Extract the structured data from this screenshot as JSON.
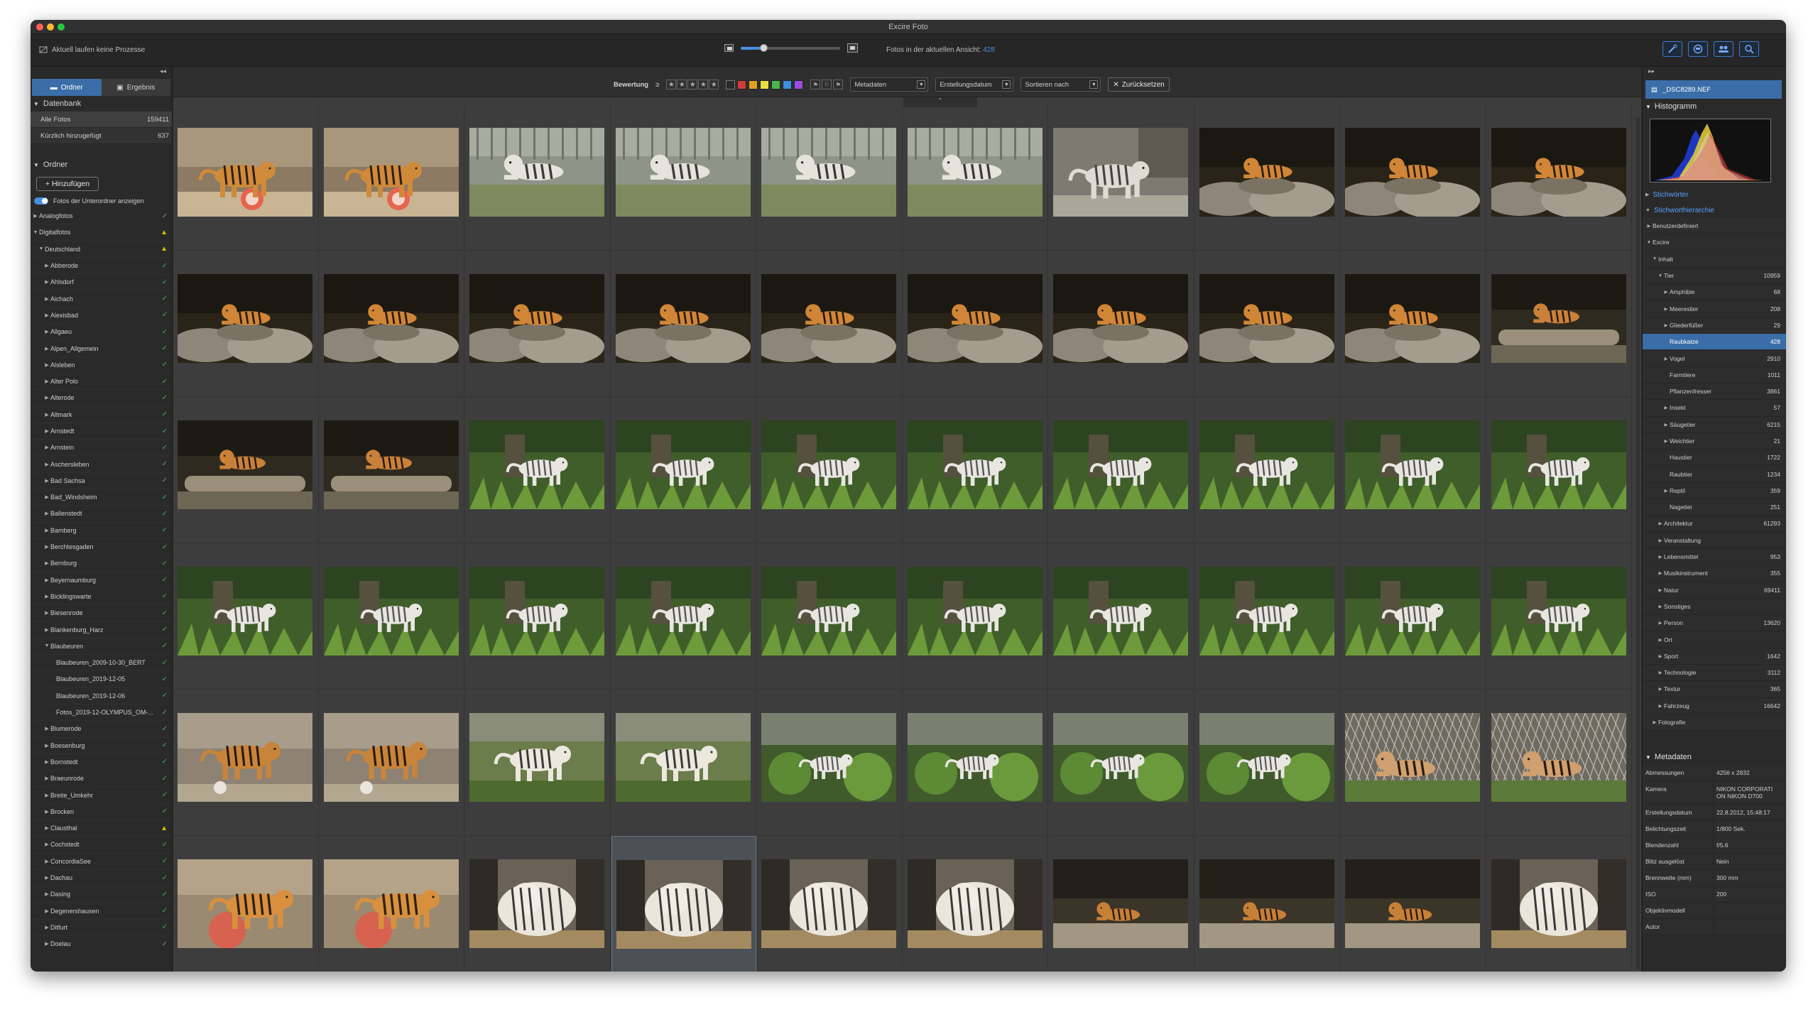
{
  "window": {
    "title": "Excire Foto"
  },
  "toolbar": {
    "process_status": "Aktuell laufen keine Prozesse",
    "zoom_level": 0.2,
    "view_count_label": "Fotos in der aktuellen Ansicht:",
    "view_count": "428",
    "icons": [
      "magic-wand-icon",
      "face-icon",
      "people-icon",
      "search-icon"
    ]
  },
  "left_panel": {
    "collapse_label": "◂◂",
    "tabs": [
      {
        "label": "Ordner",
        "icon": "folder-icon",
        "active": true
      },
      {
        "label": "Ergebnis",
        "icon": "result-icon",
        "active": false
      }
    ],
    "database": {
      "title": "Datenbank",
      "rows": [
        {
          "label": "Alle Fotos",
          "count": "159411"
        },
        {
          "label": "Kürzlich hinzugefügt",
          "count": "637"
        }
      ]
    },
    "folders": {
      "title": "Ordner",
      "add_label": "+ Hinzufügen",
      "subfolder_toggle": "Fotos der Unterordner anzeigen",
      "tree": [
        {
          "label": "Analogfotos",
          "indent": 0,
          "arrow": "▶",
          "status": "ok"
        },
        {
          "label": "Digitalfotos",
          "indent": 0,
          "arrow": "▼",
          "status": "warn"
        },
        {
          "label": "Deutschland",
          "indent": 1,
          "arrow": "▼",
          "status": "warn"
        },
        {
          "label": "Abberode",
          "indent": 2,
          "arrow": "▶",
          "status": "ok"
        },
        {
          "label": "Ahlsdorf",
          "indent": 2,
          "arrow": "▶",
          "status": "ok"
        },
        {
          "label": "Aichach",
          "indent": 2,
          "arrow": "▶",
          "status": "ok"
        },
        {
          "label": "Alexisbad",
          "indent": 2,
          "arrow": "▶",
          "status": "ok"
        },
        {
          "label": "Allgaeu",
          "indent": 2,
          "arrow": "▶",
          "status": "ok"
        },
        {
          "label": "Alpen_Allgemein",
          "indent": 2,
          "arrow": "▶",
          "status": "ok"
        },
        {
          "label": "Alsleben",
          "indent": 2,
          "arrow": "▶",
          "status": "ok"
        },
        {
          "label": "Alter Polo",
          "indent": 2,
          "arrow": "▶",
          "status": "ok"
        },
        {
          "label": "Alterode",
          "indent": 2,
          "arrow": "▶",
          "status": "ok"
        },
        {
          "label": "Altmark",
          "indent": 2,
          "arrow": "▶",
          "status": "ok"
        },
        {
          "label": "Arnstedt",
          "indent": 2,
          "arrow": "▶",
          "status": "ok"
        },
        {
          "label": "Arnstein",
          "indent": 2,
          "arrow": "▶",
          "status": "ok"
        },
        {
          "label": "Aschersleben",
          "indent": 2,
          "arrow": "▶",
          "status": "ok"
        },
        {
          "label": "Bad Sachsa",
          "indent": 2,
          "arrow": "▶",
          "status": "ok"
        },
        {
          "label": "Bad_Windsheim",
          "indent": 2,
          "arrow": "▶",
          "status": "ok"
        },
        {
          "label": "Ballenstedt",
          "indent": 2,
          "arrow": "▶",
          "status": "ok"
        },
        {
          "label": "Bamberg",
          "indent": 2,
          "arrow": "▶",
          "status": "ok"
        },
        {
          "label": "Berchtesgaden",
          "indent": 2,
          "arrow": "▶",
          "status": "ok"
        },
        {
          "label": "Bernburg",
          "indent": 2,
          "arrow": "▶",
          "status": "ok"
        },
        {
          "label": "Beyernaumburg",
          "indent": 2,
          "arrow": "▶",
          "status": "ok"
        },
        {
          "label": "Bicklingswarte",
          "indent": 2,
          "arrow": "▶",
          "status": "ok"
        },
        {
          "label": "Biesenrode",
          "indent": 2,
          "arrow": "▶",
          "status": "ok"
        },
        {
          "label": "Blankenburg_Harz",
          "indent": 2,
          "arrow": "▶",
          "status": "ok"
        },
        {
          "label": "Blaubeuren",
          "indent": 2,
          "arrow": "▼",
          "status": "ok"
        },
        {
          "label": "Blaubeuren_2009-10-30_BERT",
          "indent": 3,
          "arrow": "",
          "status": "ok"
        },
        {
          "label": "Blaubeuren_2019-12-05",
          "indent": 3,
          "arrow": "",
          "status": "ok"
        },
        {
          "label": "Blaubeuren_2019-12-06",
          "indent": 3,
          "arrow": "",
          "status": "ok"
        },
        {
          "label": "Fotos_2019-12-OLYMPUS_OM-...",
          "indent": 3,
          "arrow": "",
          "status": "ok"
        },
        {
          "label": "Blumerode",
          "indent": 2,
          "arrow": "▶",
          "status": "ok"
        },
        {
          "label": "Boesenburg",
          "indent": 2,
          "arrow": "▶",
          "status": "ok"
        },
        {
          "label": "Bornstedt",
          "indent": 2,
          "arrow": "▶",
          "status": "ok"
        },
        {
          "label": "Braeunrode",
          "indent": 2,
          "arrow": "▶",
          "status": "ok"
        },
        {
          "label": "Breite_Umkehr",
          "indent": 2,
          "arrow": "▶",
          "status": "ok"
        },
        {
          "label": "Brocken",
          "indent": 2,
          "arrow": "▶",
          "status": "ok"
        },
        {
          "label": "Clausthal",
          "indent": 2,
          "arrow": "▶",
          "status": "warn"
        },
        {
          "label": "Cochstedt",
          "indent": 2,
          "arrow": "▶",
          "status": "ok"
        },
        {
          "label": "ConcordiaSee",
          "indent": 2,
          "arrow": "▶",
          "status": "ok"
        },
        {
          "label": "Dachau",
          "indent": 2,
          "arrow": "▶",
          "status": "ok"
        },
        {
          "label": "Dasing",
          "indent": 2,
          "arrow": "▶",
          "status": "ok"
        },
        {
          "label": "Degenershausen",
          "indent": 2,
          "arrow": "▶",
          "status": "ok"
        },
        {
          "label": "Ditfurt",
          "indent": 2,
          "arrow": "▶",
          "status": "ok"
        },
        {
          "label": "Doelau",
          "indent": 2,
          "arrow": "▶",
          "status": "ok"
        }
      ]
    }
  },
  "filter_bar": {
    "rating_label": "Bewertung",
    "rating_op": "≥",
    "stars": [
      "★",
      "★",
      "★",
      "★",
      "★"
    ],
    "colors": [
      "#d33b3b",
      "#e0a020",
      "#e8e040",
      "#49b54a",
      "#3b8fe0",
      "#9b4be0"
    ],
    "flags": [
      "⚑",
      "⚐",
      "⚑"
    ],
    "dropdowns": [
      "Metadaten",
      "Erstellungsdatum",
      "Sortieren nach"
    ],
    "reset_label": "Zurücksetzen",
    "collapse_icon": "⌃"
  },
  "grid": {
    "rows": [
      [
        "tiger-walk",
        "tiger-walk",
        "whitetiger-lying",
        "whitetiger-lying",
        "whitetiger-lying",
        "whitetiger-lying",
        "whitetiger-walk",
        "tiger-rocks",
        "tiger-rocks",
        "tiger-rocks"
      ],
      [
        "tiger-rocks",
        "tiger-rocks",
        "tiger-rocks",
        "tiger-rocks",
        "tiger-rocks",
        "tiger-rocks",
        "tiger-rocks",
        "tiger-rocks",
        "tiger-rocks",
        "tiger-log"
      ],
      [
        "tiger-log",
        "tiger-log",
        "whitetiger-green",
        "whitetiger-green",
        "whitetiger-green",
        "whitetiger-green",
        "whitetiger-green",
        "whitetiger-green",
        "whitetiger-green",
        "whitetiger-green"
      ],
      [
        "whitetiger-green",
        "whitetiger-green",
        "whitetiger-green",
        "whitetiger-green",
        "whitetiger-green",
        "whitetiger-green",
        "whitetiger-green",
        "whitetiger-green",
        "whitetiger-green",
        "whitetiger-green"
      ],
      [
        "tiger-stand",
        "tiger-stand",
        "whitetiger-walkgreen",
        "whitetiger-walkgreen",
        "whitetiger-bush",
        "whitetiger-bush",
        "whitetiger-bush",
        "whitetiger-bush",
        "tiger-fence",
        "tiger-fence"
      ],
      [
        "tiger-eat",
        "tiger-eat",
        "whitetiger-close",
        "whitetiger-close",
        "whitetiger-close",
        "whitetiger-close",
        "tiger-lying",
        "tiger-lying",
        "tiger-lying",
        "whitetiger-close"
      ]
    ],
    "selected": "5-3"
  },
  "right_panel": {
    "collapse_label": "▸▸",
    "file_name": "_DSC8289.NEF",
    "histogram_title": "Histogramm",
    "keywords_title": "Stichwörter",
    "hierarchy_title": "Stichworthierarchie",
    "keywords": [
      {
        "label": "Benutzerdefiniert",
        "count": "",
        "indent": 0,
        "arrow": "▶"
      },
      {
        "label": "Excire",
        "count": "",
        "indent": 0,
        "arrow": "▼"
      },
      {
        "label": "Inhalt",
        "count": "",
        "indent": 1,
        "arrow": "▼"
      },
      {
        "label": "Tier",
        "count": "10959",
        "indent": 2,
        "arrow": "▼"
      },
      {
        "label": "Amphibie",
        "count": "68",
        "indent": 3,
        "arrow": "▶"
      },
      {
        "label": "Meerestier",
        "count": "208",
        "indent": 3,
        "arrow": "▶"
      },
      {
        "label": "Gliederfüßer",
        "count": "29",
        "indent": 3,
        "arrow": "▶"
      },
      {
        "label": "Raubkatze",
        "count": "428",
        "indent": 3,
        "arrow": "",
        "sel": true
      },
      {
        "label": "Vogel",
        "count": "2910",
        "indent": 3,
        "arrow": "▶"
      },
      {
        "label": "Farmtiere",
        "count": "1011",
        "indent": 3,
        "arrow": ""
      },
      {
        "label": "Pflanzenfresser",
        "count": "3861",
        "indent": 3,
        "arrow": ""
      },
      {
        "label": "Insekt",
        "count": "57",
        "indent": 3,
        "arrow": "▶"
      },
      {
        "label": "Säugetier",
        "count": "6215",
        "indent": 3,
        "arrow": "▶"
      },
      {
        "label": "Weichtier",
        "count": "21",
        "indent": 3,
        "arrow": "▶"
      },
      {
        "label": "Haustier",
        "count": "1722",
        "indent": 3,
        "arrow": ""
      },
      {
        "label": "Raubtier",
        "count": "1234",
        "indent": 3,
        "arrow": ""
      },
      {
        "label": "Reptil",
        "count": "359",
        "indent": 3,
        "arrow": "▶"
      },
      {
        "label": "Nagetier",
        "count": "251",
        "indent": 3,
        "arrow": ""
      },
      {
        "label": "Architektur",
        "count": "61293",
        "indent": 2,
        "arrow": "▶"
      },
      {
        "label": "Veranstaltung",
        "count": "",
        "indent": 2,
        "arrow": "▶"
      },
      {
        "label": "Lebensmittel",
        "count": "953",
        "indent": 2,
        "arrow": "▶"
      },
      {
        "label": "Musikinstrument",
        "count": "355",
        "indent": 2,
        "arrow": "▶"
      },
      {
        "label": "Natur",
        "count": "69411",
        "indent": 2,
        "arrow": "▶"
      },
      {
        "label": "Sonstiges",
        "count": "",
        "indent": 2,
        "arrow": "▶"
      },
      {
        "label": "Person",
        "count": "13620",
        "indent": 2,
        "arrow": "▶"
      },
      {
        "label": "Ort",
        "count": "",
        "indent": 2,
        "arrow": "▶"
      },
      {
        "label": "Sport",
        "count": "1642",
        "indent": 2,
        "arrow": "▶"
      },
      {
        "label": "Technologie",
        "count": "3112",
        "indent": 2,
        "arrow": "▶"
      },
      {
        "label": "Textur",
        "count": "365",
        "indent": 2,
        "arrow": "▶"
      },
      {
        "label": "Fahrzeug",
        "count": "16642",
        "indent": 2,
        "arrow": "▶"
      },
      {
        "label": "Fotografie",
        "count": "",
        "indent": 1,
        "arrow": "▶"
      }
    ],
    "metadata_title": "Metadaten",
    "metadata": [
      {
        "k": "Abmessungen",
        "v": "4256 x 2832"
      },
      {
        "k": "Kamera",
        "v": "NIKON CORPORATI ON NIKON D700"
      },
      {
        "k": "Erstellungsdatum",
        "v": "22.8.2012, 15:48:17"
      },
      {
        "k": "Belichtungszeit",
        "v": "1/800 Sek."
      },
      {
        "k": "Blendenzahl",
        "v": "f/5.6"
      },
      {
        "k": "Blitz ausgelöst",
        "v": "Nein"
      },
      {
        "k": "Brennweite (mm)",
        "v": "300 mm"
      },
      {
        "k": "ISO",
        "v": "200"
      },
      {
        "k": "Objektivmodell",
        "v": ""
      },
      {
        "k": "Autor",
        "v": ""
      }
    ]
  }
}
